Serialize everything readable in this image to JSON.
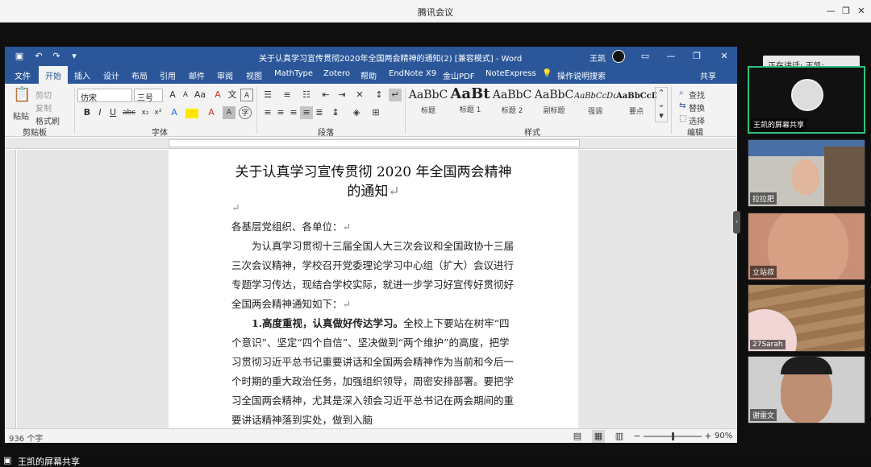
{
  "meeting": {
    "title": "腾讯会议",
    "window_controls": [
      "—",
      "❐",
      "✕"
    ],
    "footer": "王凯的屏幕共享",
    "speaking": "正在讲话: 王凯;"
  },
  "word": {
    "doc_name": "关于认真学习宣传贯彻2020年全国两会精神的通知(2) [兼容模式] - Word",
    "user": "王凯",
    "tabs": [
      "文件",
      "开始",
      "插入",
      "设计",
      "布局",
      "引用",
      "邮件",
      "审阅",
      "视图",
      "MathType",
      "Zotero",
      "帮助",
      "EndNote X9",
      "金山PDF",
      "NoteExpress",
      "操作说明搜索",
      "共享"
    ],
    "ribbon": {
      "clipboard": {
        "paste": "粘贴",
        "cut": "剪切",
        "copy": "复制",
        "format_painter": "格式刷",
        "label": "剪贴板"
      },
      "font": {
        "name": "仿宋",
        "size": "三号",
        "label": "字体"
      },
      "paragraph_label": "段落",
      "styles": [
        {
          "preview": "AaBbC",
          "name": "标题"
        },
        {
          "preview": "AaBt",
          "name": "标题 1"
        },
        {
          "preview": "AaBbC",
          "name": "标题 2"
        },
        {
          "preview": "AaBbC",
          "name": "副标题"
        },
        {
          "preview": "AaBbCcDc",
          "name": "强调"
        },
        {
          "preview": "AaBbCcD",
          "name": "要点"
        }
      ],
      "styles_label": "样式",
      "editing": {
        "find": "查找",
        "replace": "替换",
        "select": "选择",
        "label": "编辑"
      }
    },
    "document": {
      "title_line1": "关于认真学习宣传贯彻 2020 年全国两会精神",
      "title_line2": "的通知",
      "salutation": "各基层党组织、各单位：",
      "para1": "为认真学习贯彻十三届全国人大三次会议和全国政协十三届三次会议精神，学校召开党委理论学习中心组（扩大）会议进行专题学习传达，现结合学校实际，就进一步学习好宣传好贯彻好全国两会精神通知如下：",
      "item1_head": "1.高度重视，认真做好传达学习。",
      "item1_body": "全校上下要站在树牢“四个意识”、坚定“四个自信”、坚决做到“两个维护”的高度，把学习贯彻习近平总书记重要讲话和全国两会精神作为当前和今后一个时期的重大政治任务，加强组织领导，周密安排部署。要把学习全国两会精神，尤其是深入领会习近平总书记在两会期间的重要讲话精神落到实处，做到入脑"
    },
    "status": {
      "word_count": "936 个字",
      "zoom": "90%",
      "zoom_level": 0.5
    }
  },
  "participants": [
    {
      "name": "王凯的屏幕共享"
    },
    {
      "name": "拉拉肥"
    },
    {
      "name": "立站叔"
    },
    {
      "name": "27Sarah"
    },
    {
      "name": "谢雷文"
    }
  ]
}
